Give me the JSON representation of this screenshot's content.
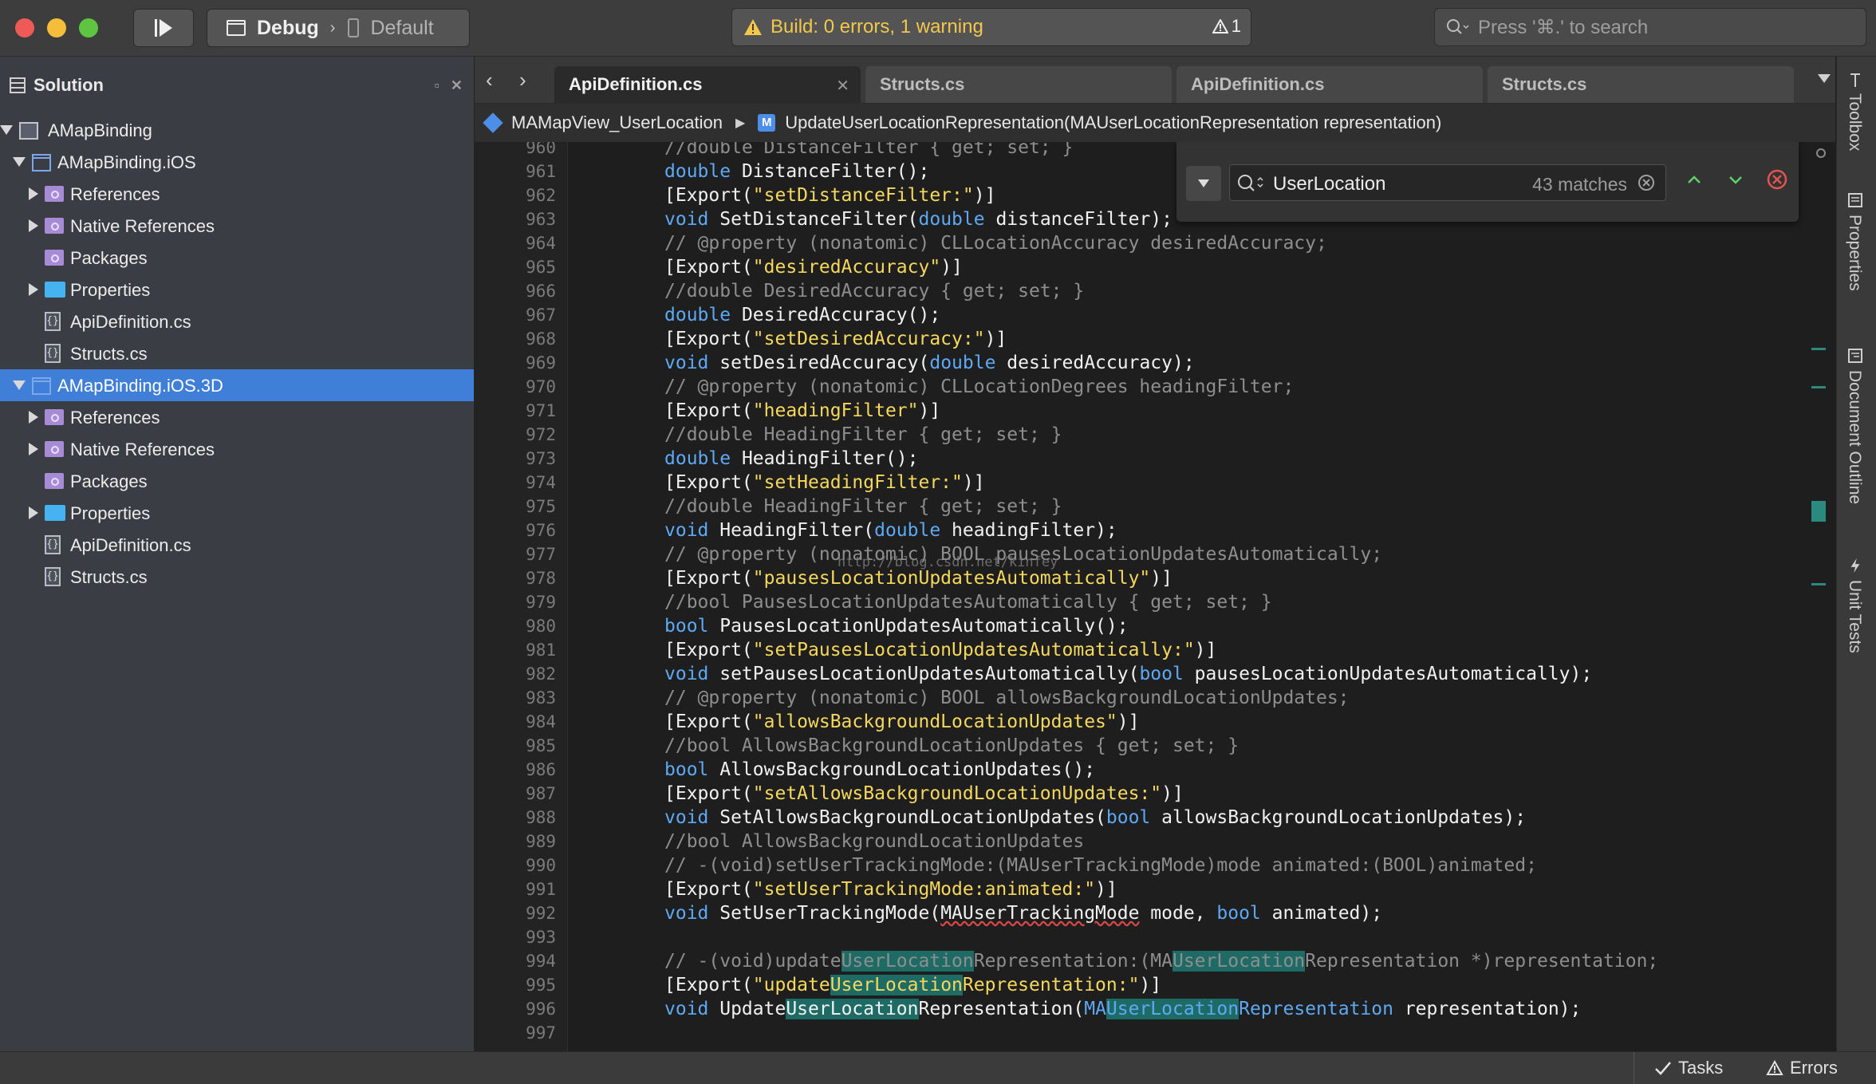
{
  "toolbar": {
    "configuration": "Debug",
    "device": "Default",
    "build_status": "Build: 0 errors, 1 warning",
    "warning_count": "1",
    "search_placeholder": "Press '⌘.' to search"
  },
  "solution_pad": {
    "title": "Solution",
    "tree": [
      {
        "label": "AMapBinding",
        "kind": "solution",
        "depth": 0,
        "expander": "open",
        "selected": false
      },
      {
        "label": "AMapBinding.iOS",
        "kind": "project",
        "depth": 1,
        "expander": "open",
        "selected": false
      },
      {
        "label": "References",
        "kind": "reference",
        "depth": 2,
        "expander": "closed",
        "selected": false
      },
      {
        "label": "Native References",
        "kind": "reference",
        "depth": 2,
        "expander": "closed",
        "selected": false
      },
      {
        "label": "Packages",
        "kind": "reference",
        "depth": 2,
        "expander": "none",
        "selected": false
      },
      {
        "label": "Properties",
        "kind": "folder",
        "depth": 2,
        "expander": "closed",
        "selected": false
      },
      {
        "label": "ApiDefinition.cs",
        "kind": "cs",
        "depth": 2,
        "expander": "none",
        "selected": false
      },
      {
        "label": "Structs.cs",
        "kind": "cs",
        "depth": 2,
        "expander": "none",
        "selected": false
      },
      {
        "label": "AMapBinding.iOS.3D",
        "kind": "project",
        "depth": 1,
        "expander": "open",
        "selected": true
      },
      {
        "label": "References",
        "kind": "reference",
        "depth": 2,
        "expander": "closed",
        "selected": false
      },
      {
        "label": "Native References",
        "kind": "reference",
        "depth": 2,
        "expander": "closed",
        "selected": false
      },
      {
        "label": "Packages",
        "kind": "reference",
        "depth": 2,
        "expander": "none",
        "selected": false
      },
      {
        "label": "Properties",
        "kind": "folder",
        "depth": 2,
        "expander": "closed",
        "selected": false
      },
      {
        "label": "ApiDefinition.cs",
        "kind": "cs",
        "depth": 2,
        "expander": "none",
        "selected": false
      },
      {
        "label": "Structs.cs",
        "kind": "cs",
        "depth": 2,
        "expander": "none",
        "selected": false
      }
    ]
  },
  "tabs": [
    {
      "label": "ApiDefinition.cs",
      "active": true
    },
    {
      "label": "Structs.cs",
      "active": false
    },
    {
      "label": "ApiDefinition.cs",
      "active": false
    },
    {
      "label": "Structs.cs",
      "active": false
    }
  ],
  "breadcrumb": {
    "class_name": "MAMapView_UserLocation",
    "method": "UpdateUserLocationRepresentation(MAUserLocationRepresentation representation)"
  },
  "find": {
    "query": "UserLocation",
    "matches": "43 matches"
  },
  "watermark": "http://blog.csdn.net/kinfey",
  "code_lines": [
    {
      "n": "960",
      "segs": [
        [
          "c",
          "//double DistanceFilter { get; set; }"
        ]
      ]
    },
    {
      "n": "961",
      "segs": [
        [
          "k",
          "double"
        ],
        [
          "p",
          " DistanceFilter();"
        ]
      ]
    },
    {
      "n": "962",
      "segs": [
        [
          "p",
          "[Export("
        ],
        [
          "s",
          "\"setDistanceFilter:\""
        ],
        [
          "p",
          ")]"
        ]
      ]
    },
    {
      "n": "963",
      "segs": [
        [
          "k",
          "void"
        ],
        [
          "p",
          " SetDistanceFilter("
        ],
        [
          "k",
          "double"
        ],
        [
          "p",
          " distanceFilter);"
        ]
      ]
    },
    {
      "n": "964",
      "segs": [
        [
          "c",
          "// @property (nonatomic) CLLocationAccuracy desiredAccuracy;"
        ]
      ]
    },
    {
      "n": "965",
      "segs": [
        [
          "p",
          "[Export("
        ],
        [
          "s",
          "\"desiredAccuracy\""
        ],
        [
          "p",
          ")]"
        ]
      ]
    },
    {
      "n": "966",
      "segs": [
        [
          "c",
          "//double DesiredAccuracy { get; set; }"
        ]
      ]
    },
    {
      "n": "967",
      "segs": [
        [
          "k",
          "double"
        ],
        [
          "p",
          " DesiredAccuracy();"
        ]
      ]
    },
    {
      "n": "968",
      "segs": [
        [
          "p",
          "[Export("
        ],
        [
          "s",
          "\"setDesiredAccuracy:\""
        ],
        [
          "p",
          ")]"
        ]
      ]
    },
    {
      "n": "969",
      "segs": [
        [
          "k",
          "void"
        ],
        [
          "p",
          " setDesiredAccuracy("
        ],
        [
          "k",
          "double"
        ],
        [
          "p",
          " desiredAccuracy);"
        ]
      ]
    },
    {
      "n": "970",
      "segs": [
        [
          "c",
          "// @property (nonatomic) CLLocationDegrees headingFilter;"
        ]
      ]
    },
    {
      "n": "971",
      "segs": [
        [
          "p",
          "[Export("
        ],
        [
          "s",
          "\"headingFilter\""
        ],
        [
          "p",
          ")]"
        ]
      ]
    },
    {
      "n": "972",
      "segs": [
        [
          "c",
          "//double HeadingFilter { get; set; }"
        ]
      ]
    },
    {
      "n": "973",
      "segs": [
        [
          "k",
          "double"
        ],
        [
          "p",
          " HeadingFilter();"
        ]
      ]
    },
    {
      "n": "974",
      "segs": [
        [
          "p",
          "[Export("
        ],
        [
          "s",
          "\"setHeadingFilter:\""
        ],
        [
          "p",
          ")]"
        ]
      ]
    },
    {
      "n": "975",
      "segs": [
        [
          "c",
          "//double HeadingFilter { get; set; }"
        ]
      ]
    },
    {
      "n": "976",
      "segs": [
        [
          "k",
          "void"
        ],
        [
          "p",
          " HeadingFilter("
        ],
        [
          "k",
          "double"
        ],
        [
          "p",
          " headingFilter);"
        ]
      ]
    },
    {
      "n": "977",
      "segs": [
        [
          "c",
          "// @property (nonatomic) BOOL pausesLocationUpdatesAutomatically;"
        ]
      ]
    },
    {
      "n": "978",
      "segs": [
        [
          "p",
          "[Export("
        ],
        [
          "s",
          "\"pausesLocationUpdatesAutomatically\""
        ],
        [
          "p",
          ")]"
        ]
      ]
    },
    {
      "n": "979",
      "segs": [
        [
          "c",
          "//bool PausesLocationUpdatesAutomatically { get; set; }"
        ]
      ]
    },
    {
      "n": "980",
      "segs": [
        [
          "k",
          "bool"
        ],
        [
          "p",
          " PausesLocationUpdatesAutomatically();"
        ]
      ]
    },
    {
      "n": "981",
      "segs": [
        [
          "p",
          "[Export("
        ],
        [
          "s",
          "\"setPausesLocationUpdatesAutomatically:\""
        ],
        [
          "p",
          ")]"
        ]
      ]
    },
    {
      "n": "982",
      "segs": [
        [
          "k",
          "void"
        ],
        [
          "p",
          " setPausesLocationUpdatesAutomatically("
        ],
        [
          "k",
          "bool"
        ],
        [
          "p",
          " pausesLocationUpdatesAutomatically);"
        ]
      ]
    },
    {
      "n": "983",
      "segs": [
        [
          "c",
          "// @property (nonatomic) BOOL allowsBackgroundLocationUpdates;"
        ]
      ]
    },
    {
      "n": "984",
      "segs": [
        [
          "p",
          "[Export("
        ],
        [
          "s",
          "\"allowsBackgroundLocationUpdates\""
        ],
        [
          "p",
          ")]"
        ]
      ]
    },
    {
      "n": "985",
      "segs": [
        [
          "c",
          "//bool AllowsBackgroundLocationUpdates { get; set; }"
        ]
      ]
    },
    {
      "n": "986",
      "segs": [
        [
          "k",
          "bool"
        ],
        [
          "p",
          " AllowsBackgroundLocationUpdates();"
        ]
      ]
    },
    {
      "n": "987",
      "segs": [
        [
          "p",
          "[Export("
        ],
        [
          "s",
          "\"setAllowsBackgroundLocationUpdates:\""
        ],
        [
          "p",
          ")]"
        ]
      ]
    },
    {
      "n": "988",
      "segs": [
        [
          "k",
          "void"
        ],
        [
          "p",
          " SetAllowsBackgroundLocationUpdates("
        ],
        [
          "k",
          "bool"
        ],
        [
          "p",
          " allowsBackgroundLocationUpdates);"
        ]
      ]
    },
    {
      "n": "989",
      "segs": [
        [
          "c",
          "//bool AllowsBackgroundLocationUpdates"
        ]
      ]
    },
    {
      "n": "990",
      "segs": [
        [
          "c",
          "// -(void)setUserTrackingMode:(MAUserTrackingMode)mode animated:(BOOL)animated;"
        ]
      ]
    },
    {
      "n": "991",
      "segs": [
        [
          "p",
          "[Export("
        ],
        [
          "s",
          "\"setUserTrackingMode:animated:\""
        ],
        [
          "p",
          ")]"
        ]
      ]
    },
    {
      "n": "992",
      "segs": [
        [
          "k",
          "void"
        ],
        [
          "p",
          " SetUserTrackingMode("
        ],
        [
          "e",
          "MAUserTrackingMode"
        ],
        [
          "p",
          " mode, "
        ],
        [
          "k",
          "bool"
        ],
        [
          "p",
          " animated);"
        ]
      ]
    },
    {
      "n": "993",
      "segs": []
    },
    {
      "n": "994",
      "segs": [
        [
          "c",
          "// -(void)update"
        ],
        [
          "ch",
          "UserLocation"
        ],
        [
          "c",
          "Representation:(MA"
        ],
        [
          "ch",
          "UserLocation"
        ],
        [
          "c",
          "Representation *)representation;"
        ]
      ]
    },
    {
      "n": "995",
      "segs": [
        [
          "p",
          "[Export("
        ],
        [
          "s",
          "\"update"
        ],
        [
          "sh",
          "UserLocation"
        ],
        [
          "s",
          "Representation:\""
        ],
        [
          "p",
          ")]"
        ]
      ]
    },
    {
      "n": "996",
      "segs": [
        [
          "k",
          "void"
        ],
        [
          "p",
          " Update"
        ],
        [
          "ph",
          "UserLocation"
        ],
        [
          "p",
          "Representation("
        ],
        [
          "k",
          "MA"
        ],
        [
          "kh",
          "UserLocation"
        ],
        [
          "k",
          "Representation"
        ],
        [
          "p",
          " representation);"
        ]
      ]
    },
    {
      "n": "997",
      "segs": []
    }
  ],
  "right_pads": [
    "Toolbox",
    "Properties",
    "Document Outline",
    "Unit Tests"
  ],
  "statusbar": {
    "tasks": "Tasks",
    "errors": "Errors"
  },
  "colors": {
    "keyword": "#5da9f5",
    "string": "#f5d85c",
    "comment": "#8e8e8e",
    "match_highlight": "#1e6b66",
    "selection": "#3f7fd8",
    "warning": "#f2c84b"
  }
}
